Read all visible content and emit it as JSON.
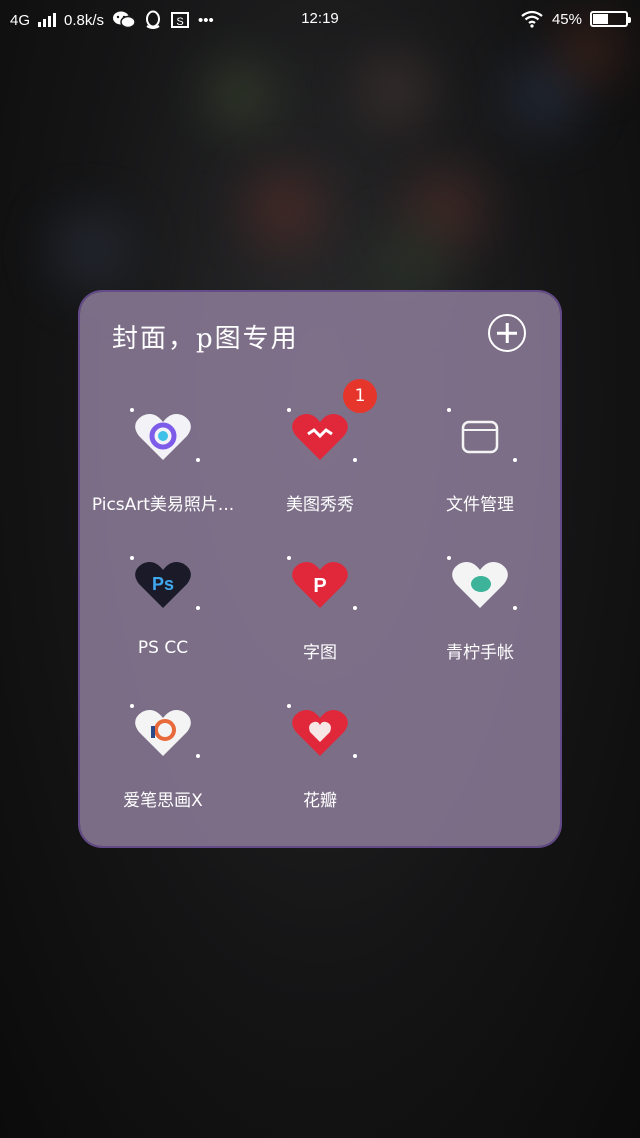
{
  "status_bar": {
    "network": "4G",
    "speed": "0.8k/s",
    "time": "12:19",
    "battery": "45%",
    "battery_level": 0.45,
    "overflow": "•••"
  },
  "folder": {
    "title": "封面，p图专用",
    "apps": [
      {
        "label": "PicsArt美易照片...",
        "icon": "picsart-icon"
      },
      {
        "label": "美图秀秀",
        "icon": "meitu-icon",
        "badge": "1"
      },
      {
        "label": "文件管理",
        "icon": "file-manager-icon"
      },
      {
        "label": "PS CC",
        "icon": "photoshop-icon"
      },
      {
        "label": "字图",
        "icon": "zitu-icon"
      },
      {
        "label": "青柠手帐",
        "icon": "qingning-icon"
      },
      {
        "label": "爱笔思画X",
        "icon": "ibispaint-icon"
      },
      {
        "label": "花瓣",
        "icon": "huaban-icon"
      }
    ]
  },
  "colors": {
    "folder_bg": "#8a7a96",
    "badge": "#e6352b",
    "heart_red": "#e0283a",
    "heart_white": "#f4f4f4",
    "heart_dark": "#1a1a28"
  }
}
